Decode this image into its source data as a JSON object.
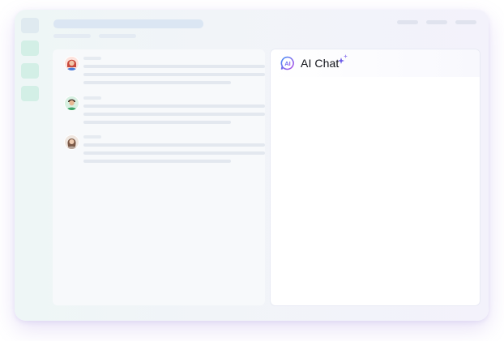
{
  "app": {
    "sidebar": {
      "items": [
        "nav-item-1",
        "nav-item-2",
        "nav-item-3",
        "nav-item-4"
      ]
    },
    "comments": [
      {
        "avatar": "avatar-woman-red-hair",
        "avatar_color": "#f26b6b"
      },
      {
        "avatar": "avatar-man-green-shirt",
        "avatar_color": "#66c58d"
      },
      {
        "avatar": "avatar-woman-brown-hair",
        "avatar_color": "#8c6b55"
      }
    ],
    "ai_chat": {
      "title": "AI Chat",
      "logo_icon": "ai-logo-icon",
      "sparkle_icon": "sparkle-icon",
      "accent": "#6d5ce8"
    }
  }
}
